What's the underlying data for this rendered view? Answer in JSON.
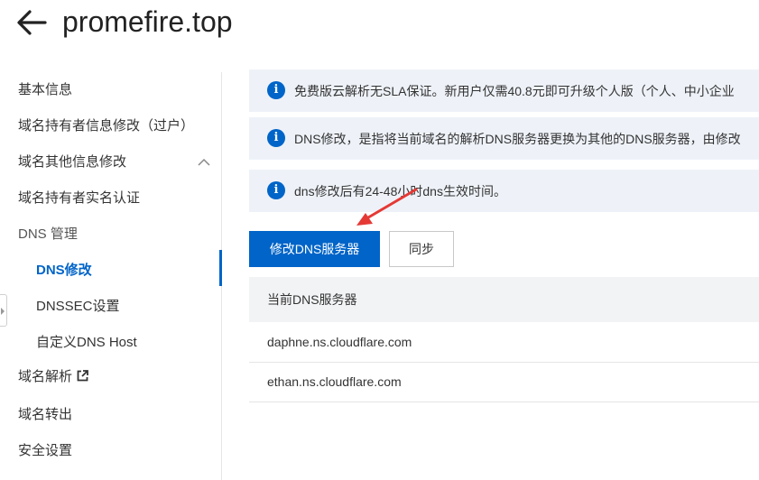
{
  "header": {
    "title": "promefire.top"
  },
  "sidebar": {
    "items": [
      {
        "label": "基本信息"
      },
      {
        "label": "域名持有者信息修改（过户）"
      },
      {
        "label": "域名其他信息修改"
      },
      {
        "label": "域名持有者实名认证"
      },
      {
        "label": "DNS 管理"
      },
      {
        "label": "DNS修改"
      },
      {
        "label": "DNSSEC设置"
      },
      {
        "label": "自定义DNS Host"
      },
      {
        "label": "域名解析"
      },
      {
        "label": "域名转出"
      },
      {
        "label": "安全设置"
      }
    ]
  },
  "notices": [
    {
      "text": "免费版云解析无SLA保证。新用户仅需40.8元即可升级个人版（个人、中小企业"
    },
    {
      "text": "DNS修改，是指将当前域名的解析DNS服务器更换为其他的DNS服务器，由修改"
    },
    {
      "text": "dns修改后有24-48小时dns生效时间。"
    }
  ],
  "actions": {
    "modify_label": "修改DNS服务器",
    "sync_label": "同步"
  },
  "dns_table": {
    "header": "当前DNS服务器",
    "rows": [
      "daphne.ns.cloudflare.com",
      "ethan.ns.cloudflare.com"
    ]
  },
  "colors": {
    "accent": "#0064c8",
    "annotation_arrow": "#e53935",
    "notice_bg": "#eef2f8"
  },
  "icons": {
    "back": "arrow-left-icon",
    "info": "info-icon",
    "external": "external-link-icon",
    "expand": "chevron-up-icon"
  }
}
